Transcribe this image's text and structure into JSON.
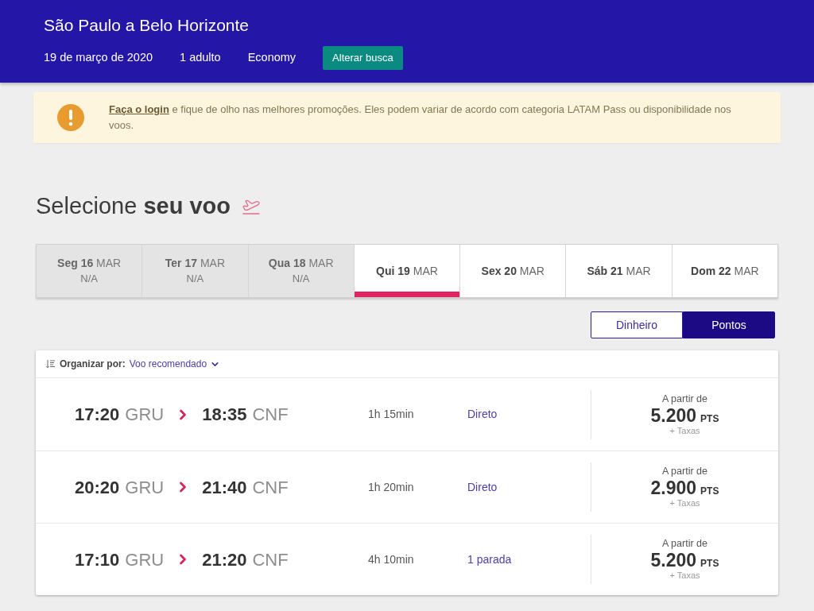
{
  "header": {
    "title": "São Paulo a Belo Horizonte",
    "date": "19 de março de 2020",
    "passengers": "1 adulto",
    "cabin": "Economy",
    "search_button": "Alterar busca"
  },
  "notice": {
    "link": "Faça o login",
    "text": "e fique de olho nas melhores promoções. Eles podem variar de acordo com categoria LATAM Pass ou disponibilidade nos voos."
  },
  "heading": "Selecione **seu voo**",
  "date_tabs": [
    {
      "day": "Seg 16",
      "month": "MAR",
      "note": "N/A",
      "disabled": true,
      "selected": false
    },
    {
      "day": "Ter 17",
      "month": "MAR",
      "note": "N/A",
      "disabled": true,
      "selected": false
    },
    {
      "day": "Qua 18",
      "month": "MAR",
      "note": "N/A",
      "disabled": true,
      "selected": false
    },
    {
      "day": "Qui 19",
      "month": "MAR",
      "disabled": false,
      "selected": true
    },
    {
      "day": "Sex 20",
      "month": "MAR",
      "disabled": false,
      "selected": false
    },
    {
      "day": "Sáb 21",
      "month": "MAR",
      "disabled": false,
      "selected": false
    },
    {
      "day": "Dom 22",
      "month": "MAR",
      "disabled": false,
      "selected": false
    }
  ],
  "fare_toggle": [
    {
      "label": "Dinheiro",
      "selected": false
    },
    {
      "label": "Pontos",
      "selected": true
    }
  ],
  "sort": {
    "label": "Organizar por:",
    "value": "Voo recomendado"
  },
  "flights": [
    {
      "departure_time": "17:20",
      "departure_airport": "GRU",
      "arrival_time": "18:35",
      "arrival_airport": "CNF",
      "duration": "1h 15min",
      "stops": "Direto",
      "price_prefix": "A partir de",
      "price": "5.200",
      "unit": "PTS",
      "fees": "+ Taxas"
    },
    {
      "departure_time": "20:20",
      "departure_airport": "GRU",
      "arrival_time": "21:40",
      "arrival_airport": "CNF",
      "duration": "1h 20min",
      "stops": "Direto",
      "price_prefix": "A partir de",
      "price": "2.900",
      "unit": "PTS",
      "fees": "+ Taxas"
    },
    {
      "departure_time": "17:10",
      "departure_airport": "GRU",
      "arrival_time": "21:20",
      "arrival_airport": "CNF",
      "duration": "4h 10min",
      "stops": "1 parada",
      "price_prefix": "A partir de",
      "price": "5.200",
      "unit": "PTS",
      "fees": "+ Taxas"
    }
  ]
}
